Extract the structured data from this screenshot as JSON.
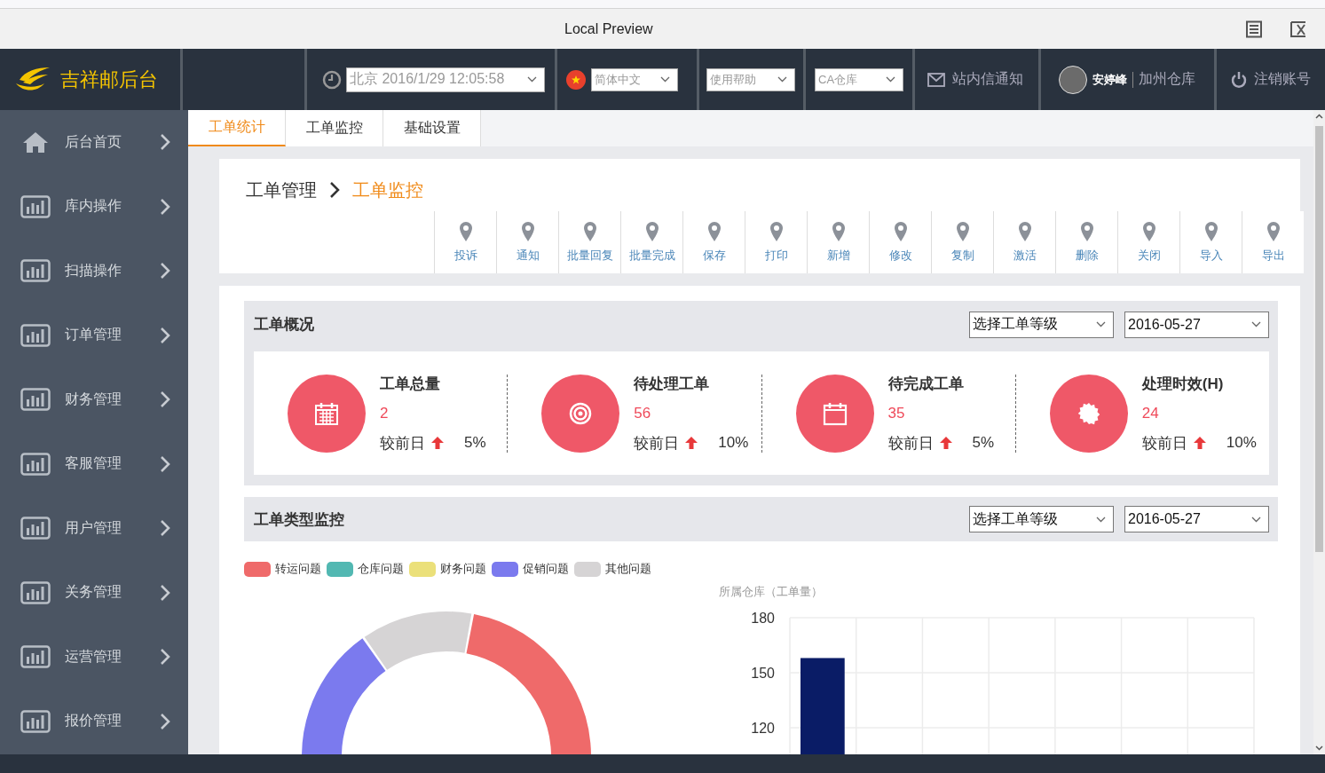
{
  "browser": {
    "title": "Local Preview"
  },
  "header": {
    "brand": "吉祥邮后台",
    "time_select": {
      "value": "北京 2016/1/29 12:05:58"
    },
    "language_select": {
      "value": "简体中文"
    },
    "help_select": {
      "value": "使用帮助"
    },
    "warehouse_select": {
      "value": "CA仓库"
    },
    "messages": "站内信通知",
    "user": {
      "name": "安婷峰",
      "warehouse": "加州仓库"
    },
    "logout": "注销账号"
  },
  "sidebar": {
    "items": [
      {
        "label": "后台首页",
        "kind": "home"
      },
      {
        "label": "库内操作",
        "kind": "chart"
      },
      {
        "label": "扫描操作",
        "kind": "chart"
      },
      {
        "label": "订单管理",
        "kind": "chart"
      },
      {
        "label": "财务管理",
        "kind": "chart"
      },
      {
        "label": "客服管理",
        "kind": "chart"
      },
      {
        "label": "用户管理",
        "kind": "chart"
      },
      {
        "label": "关务管理",
        "kind": "chart"
      },
      {
        "label": "运营管理",
        "kind": "chart"
      },
      {
        "label": "报价管理",
        "kind": "chart"
      }
    ]
  },
  "tabs": [
    {
      "label": "工单统计",
      "selected": true
    },
    {
      "label": "工单监控",
      "selected": false
    },
    {
      "label": "基础设置",
      "selected": false
    }
  ],
  "breadcrumb": [
    "工单管理",
    "工单监控"
  ],
  "toolbar": [
    "投诉",
    "通知",
    "批量回复",
    "批量完成",
    "保存",
    "打印",
    "新增",
    "修改",
    "复制",
    "激活",
    "删除",
    "关闭",
    "导入",
    "导出"
  ],
  "overview": {
    "title": "工单概况",
    "level_select": "选择工单等级",
    "date_select": "2016-05-27",
    "stats": [
      {
        "kind": "calendar-grid",
        "title": "工单总量",
        "value": "2",
        "compare": "较前日",
        "change": "5%"
      },
      {
        "kind": "target",
        "title": "待处理工单",
        "value": "56",
        "compare": "较前日",
        "change": "10%"
      },
      {
        "kind": "calendar",
        "title": "待完成工单",
        "value": "35",
        "compare": "较前日",
        "change": "5%"
      },
      {
        "kind": "seal",
        "title": "处理时效(H)",
        "value": "24",
        "compare": "较前日",
        "change": "10%"
      }
    ]
  },
  "type_monitor": {
    "title": "工单类型监控",
    "level_select": "选择工单等级",
    "date_select": "2016-05-27",
    "legend": [
      {
        "label": "转运问题",
        "color": "#ef6a6a"
      },
      {
        "label": "仓库问题",
        "color": "#52b8b2"
      },
      {
        "label": "财务问题",
        "color": "#ebe07a"
      },
      {
        "label": "促销问题",
        "color": "#7b7aee"
      },
      {
        "label": "其他问题",
        "color": "#d6d4d5"
      }
    ],
    "bar_chart": {
      "title": "所属仓库（工单量）",
      "chart_data": {
        "type": "bar",
        "ylim": [
          100,
          180
        ],
        "yticks": [
          120,
          150,
          180
        ],
        "series": [
          {
            "color": "#0a1c66",
            "values": [
              158
            ]
          }
        ]
      }
    }
  }
}
